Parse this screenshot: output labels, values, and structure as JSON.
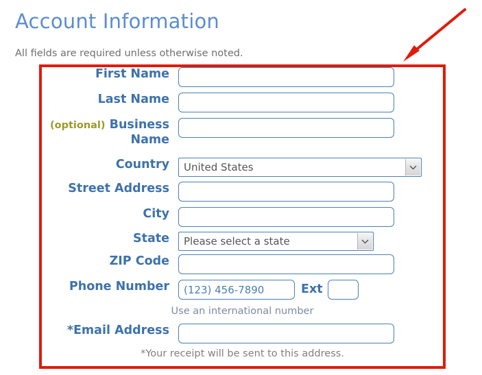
{
  "page": {
    "title": "Account Information",
    "subtitle": "All fields are required unless otherwise noted."
  },
  "colors": {
    "heading": "#5b8dd0",
    "label": "#3d72ab",
    "optional": "#9a9a28",
    "input_border": "#4a7fb5",
    "annotation": "#e01b0c",
    "helper": "#7b8ba3",
    "footnote": "#808080"
  },
  "annotation": {
    "box_name": "red-highlight-rectangle",
    "arrow_name": "red-pointer-arrow"
  },
  "form": {
    "fields": [
      {
        "name": "first-name",
        "label": "First Name",
        "optional_tag": "",
        "type": "text",
        "value": "",
        "placeholder": ""
      },
      {
        "name": "last-name",
        "label": "Last Name",
        "optional_tag": "",
        "type": "text",
        "value": "",
        "placeholder": ""
      },
      {
        "name": "business-name",
        "label": "Business Name",
        "optional_tag": "(optional)",
        "type": "text",
        "value": "",
        "placeholder": ""
      },
      {
        "name": "country",
        "label": "Country",
        "optional_tag": "",
        "type": "select",
        "value": "United States",
        "placeholder": ""
      },
      {
        "name": "street-address",
        "label": "Street Address",
        "optional_tag": "",
        "type": "text",
        "value": "",
        "placeholder": ""
      },
      {
        "name": "city",
        "label": "City",
        "optional_tag": "",
        "type": "text",
        "value": "",
        "placeholder": ""
      },
      {
        "name": "state",
        "label": "State",
        "optional_tag": "",
        "type": "select",
        "value": "Please select a state",
        "placeholder": ""
      },
      {
        "name": "zip-code",
        "label": "ZIP Code",
        "optional_tag": "",
        "type": "text",
        "value": "",
        "placeholder": ""
      },
      {
        "name": "phone-number",
        "label": "Phone Number",
        "optional_tag": "",
        "type": "phone",
        "value": "",
        "placeholder": "(123) 456-7890"
      },
      {
        "name": "email-address",
        "label": "*Email Address",
        "optional_tag": "",
        "type": "text",
        "value": "",
        "placeholder": ""
      }
    ],
    "ext": {
      "label": "Ext",
      "value": "",
      "placeholder": ""
    },
    "phone_helper": "Use an international number",
    "email_footnote": "*Your receipt will be sent to this address."
  }
}
